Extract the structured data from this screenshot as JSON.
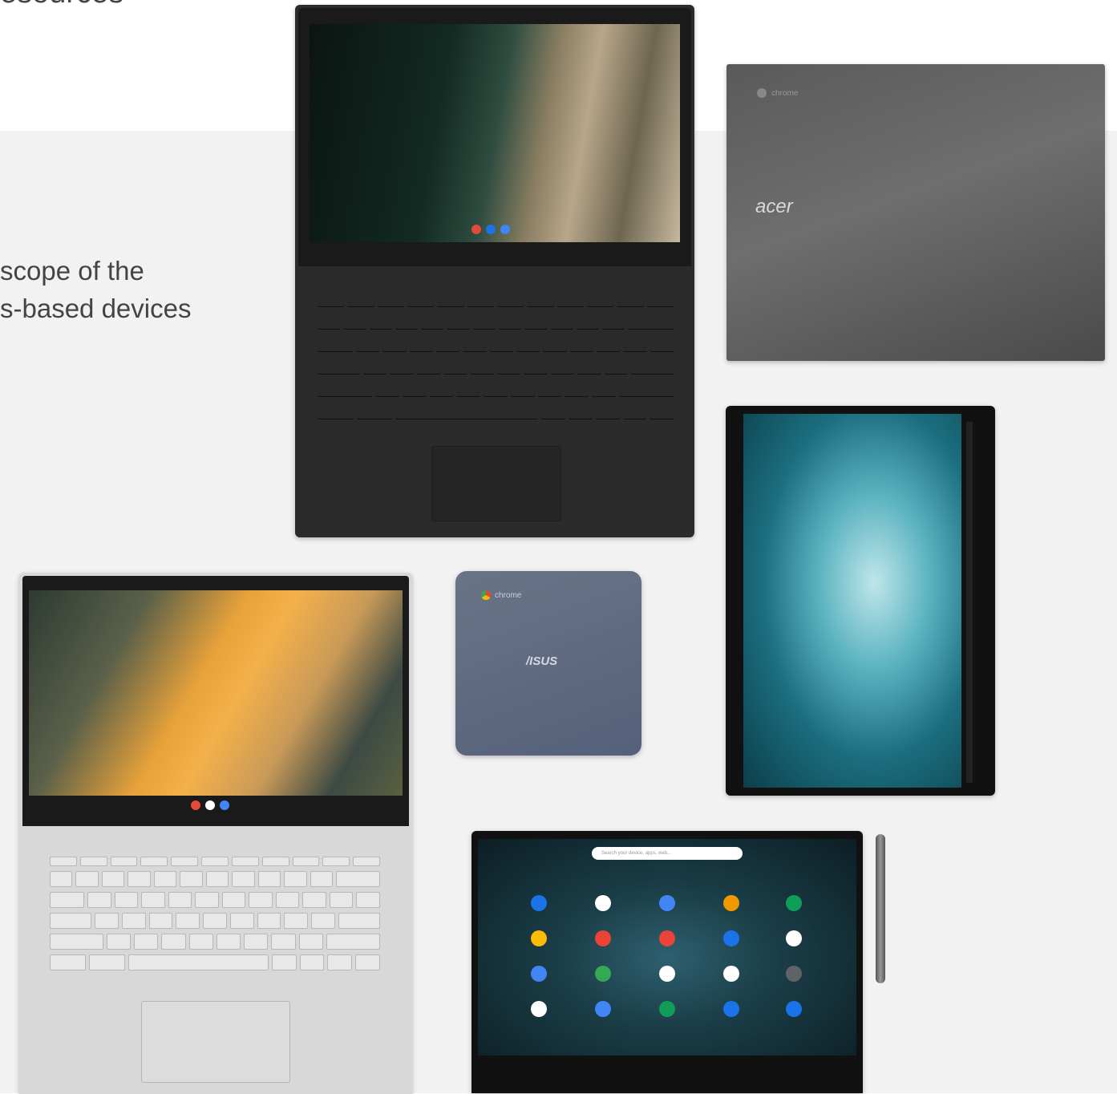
{
  "heading": {
    "text": "esources"
  },
  "intro": {
    "line1": "scope of the",
    "line2": "s-based devices"
  },
  "devices": {
    "acer": {
      "brand": "acer",
      "logo_text": "chrome"
    },
    "asus": {
      "brand": "/ISUS",
      "logo_text": "chrome"
    },
    "samsung": {
      "search_placeholder": "Search your device, apps, web..."
    }
  },
  "colors": {
    "background": "#ffffff",
    "band": "#f2f2f2",
    "text": "#444444"
  }
}
